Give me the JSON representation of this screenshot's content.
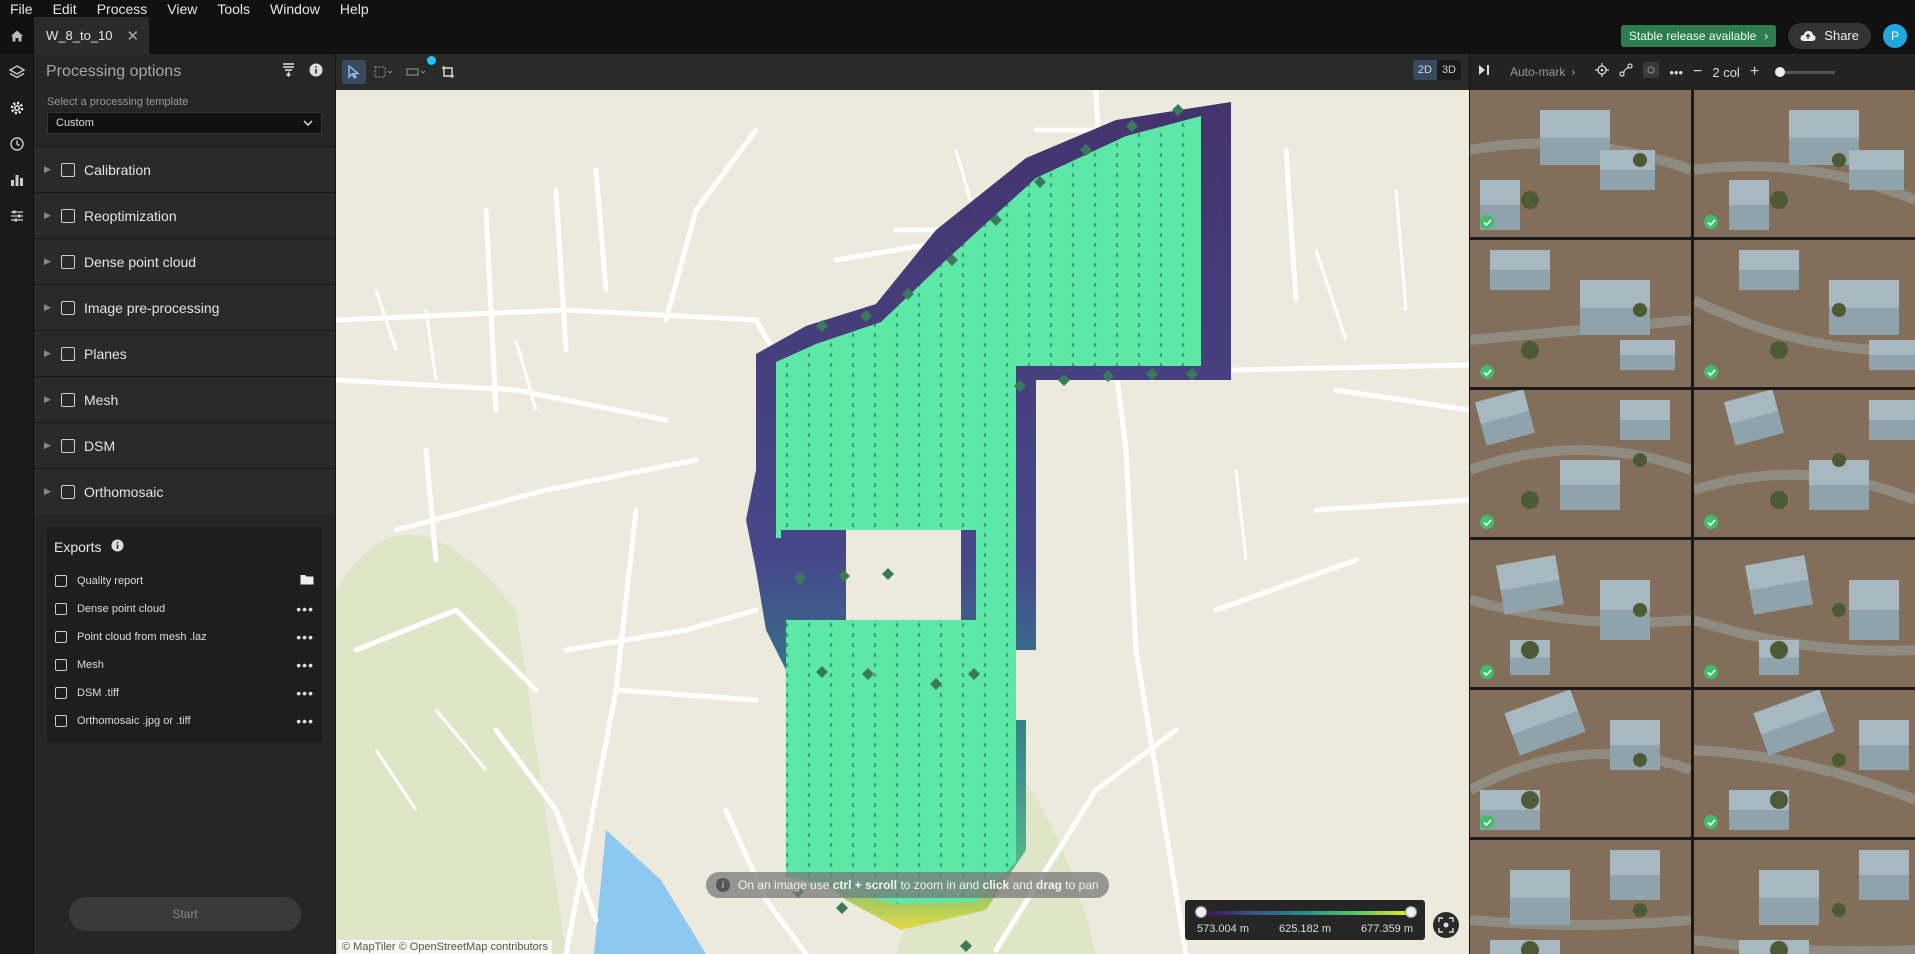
{
  "menu": [
    "File",
    "Edit",
    "Process",
    "View",
    "Tools",
    "Window",
    "Help"
  ],
  "tab": {
    "title": "W_8_to_10"
  },
  "header": {
    "release_label": "Stable release available",
    "share_label": "Share",
    "avatar_letter": "P"
  },
  "panel": {
    "title": "Processing options",
    "template_label": "Select a processing template",
    "template_value": "Custom",
    "options": [
      "Calibration",
      "Reoptimization",
      "Dense point cloud",
      "Image pre-processing",
      "Planes",
      "Mesh",
      "DSM",
      "Orthomosaic"
    ],
    "exports_title": "Exports",
    "exports": [
      "Quality report",
      "Dense point cloud",
      "Point cloud from mesh .laz",
      "Mesh",
      "DSM .tiff",
      "Orthomosaic .jpg or .tiff"
    ],
    "start_label": "Start"
  },
  "map": {
    "view_2d": "2D",
    "view_3d": "3D",
    "hint": {
      "prefix": "On an image use",
      "k1": "ctrl + scroll",
      "mid1": "to zoom in and",
      "k2": "click",
      "mid2": "and",
      "k3": "drag",
      "suffix": "to pan"
    },
    "attribution": "© MapTiler © OpenStreetMap contributors",
    "legend": {
      "min": "573.004 m",
      "mid": "625.182 m",
      "max": "677.359 m"
    },
    "colors": {
      "coverage": "#5ee8a8",
      "low": "#3b2a66",
      "high": "#e4d83a",
      "water": "#8cc8f0"
    }
  },
  "images": {
    "automark_label": "Auto-mark",
    "columns_label": "2 col",
    "thumbnails": [
      {
        "checked": true
      },
      {
        "checked": true
      },
      {
        "checked": true
      },
      {
        "checked": true
      },
      {
        "checked": true
      },
      {
        "checked": true
      },
      {
        "checked": true
      },
      {
        "checked": true
      },
      {
        "checked": true
      },
      {
        "checked": true
      },
      {
        "checked": false
      },
      {
        "checked": false
      }
    ]
  }
}
